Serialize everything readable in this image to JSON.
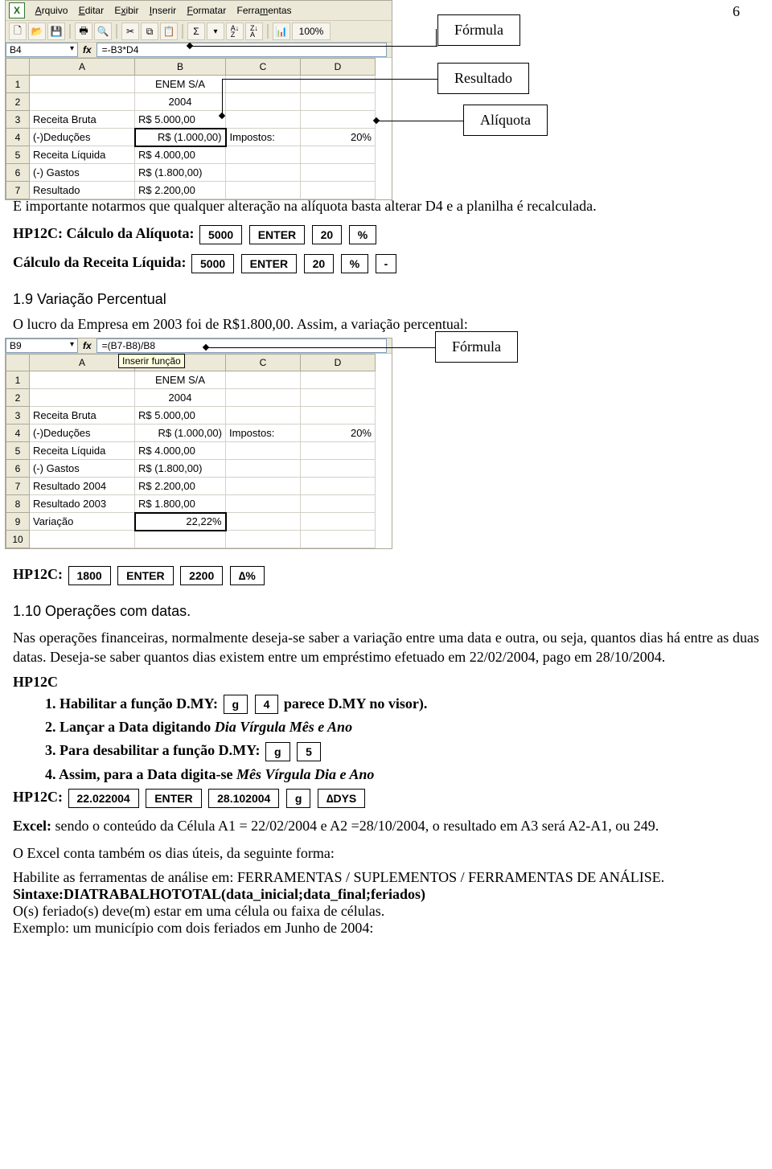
{
  "page_number": "6",
  "excel1": {
    "menu": {
      "arquivo": "Arquivo",
      "editar": "Editar",
      "exibir": "Exibir",
      "inserir": "Inserir",
      "formatar": "Formatar",
      "ferramentas": "Ferramentas"
    },
    "zoom": "100%",
    "namebox": "B4",
    "formula": "=-B3*D4",
    "cols": [
      "A",
      "B",
      "C",
      "D"
    ],
    "rows": [
      {
        "n": "1",
        "a": "",
        "b": "ENEM S/A",
        "c": "",
        "d": ""
      },
      {
        "n": "2",
        "a": "",
        "b": "2004",
        "c": "",
        "d": ""
      },
      {
        "n": "3",
        "a": "Receita Bruta",
        "b": "R$  5.000,00",
        "c": "",
        "d": ""
      },
      {
        "n": "4",
        "a": "(-)Deduções",
        "b": "R$ (1.000,00)",
        "c": "Impostos:",
        "d": "20%"
      },
      {
        "n": "5",
        "a": "Receita Líquida",
        "b": "R$  4.000,00",
        "c": "",
        "d": ""
      },
      {
        "n": "6",
        "a": "(-) Gastos",
        "b": "R$ (1.800,00)",
        "c": "",
        "d": ""
      },
      {
        "n": "7",
        "a": "Resultado",
        "b": "R$  2.200,00",
        "c": "",
        "d": ""
      }
    ]
  },
  "ann": {
    "formula": "Fórmula",
    "resultado": "Resultado",
    "aliquota": "Alíquota",
    "formula2": "Fórmula"
  },
  "para1": "É importante notarmos que qualquer alteração na alíquota basta alterar D4 e a planilha é recalculada.",
  "hp_aliq_label": "HP12C: Cálculo da Alíquota:",
  "keys1": {
    "k1": "5000",
    "k2": "ENTER",
    "k3": "20",
    "k4": "%"
  },
  "receita_label": "Cálculo da Receita Líquida:",
  "keys2": {
    "k1": "5000",
    "k2": "ENTER",
    "k3": "20",
    "k4": "%",
    "k5": "-"
  },
  "h19": "1.9  Variação Percentual",
  "para2": "O lucro da Empresa em 2003 foi de R$1.800,00. Assim, a variação percentual:",
  "excel2": {
    "namebox": "B9",
    "formula": "=(B7-B8)/B8",
    "insfunc": "Inserir função",
    "cols": [
      "A",
      "B",
      "C",
      "D"
    ],
    "rows": [
      {
        "n": "1",
        "a": "",
        "b": "ENEM S/A",
        "c": "",
        "d": ""
      },
      {
        "n": "2",
        "a": "",
        "b": "2004",
        "c": "",
        "d": ""
      },
      {
        "n": "3",
        "a": "Receita Bruta",
        "b": "R$  5.000,00",
        "c": "",
        "d": ""
      },
      {
        "n": "4",
        "a": "(-)Deduções",
        "b": "R$ (1.000,00)",
        "c": "Impostos:",
        "d": "20%"
      },
      {
        "n": "5",
        "a": "Receita Líquida",
        "b": "R$  4.000,00",
        "c": "",
        "d": ""
      },
      {
        "n": "6",
        "a": "(-) Gastos",
        "b": "R$ (1.800,00)",
        "c": "",
        "d": ""
      },
      {
        "n": "7",
        "a": "Resultado 2004",
        "b": "R$  2.200,00",
        "c": "",
        "d": ""
      },
      {
        "n": "8",
        "a": "Resultado 2003",
        "b": "R$  1.800,00",
        "c": "",
        "d": ""
      },
      {
        "n": "9",
        "a": "Variação",
        "b": "22,22%",
        "c": "",
        "d": ""
      },
      {
        "n": "10",
        "a": "",
        "b": "",
        "c": "",
        "d": ""
      }
    ]
  },
  "hp12c_l": "HP12C:",
  "keys3": {
    "k1": "1800",
    "k2": "ENTER",
    "k3": "2200",
    "k4": "∆%"
  },
  "h110": "1.10  Operações com datas.",
  "para3": "Nas operações financeiras, normalmente deseja-se saber a variação entre uma data e outra, ou seja, quantos dias há entre as duas datas. Deseja-se saber quantos dias existem entre um empréstimo efetuado em 22/02/2004, pago em 28/10/2004.",
  "hp12c_plain": "HP12C",
  "steps": {
    "s1_a": "1. Habilitar a função D.MY:",
    "s1_b": "parece D.MY no visor).",
    "s2": "2. Lançar a Data digitando ",
    "s2_i": "Dia Vírgula Mês e Ano",
    "s3": "3. Para desabilitar a função D.MY:",
    "s4": "4. Assim, para a Data digita-se ",
    "s4_i": "Mês Vírgula Dia  e Ano",
    "k_g": "g",
    "k_4": "4",
    "k_5": "5"
  },
  "keys4": {
    "k1": "22.022004",
    "k2": "ENTER",
    "k3": "28.102004",
    "k4": "g",
    "k5": "∆DYS"
  },
  "para4_a": "Excel:",
  "para4_b": " sendo o conteúdo da Célula A1 = 22/02/2004 e A2 =28/10/2004, o resultado em A3 será A2-A1, ou 249.",
  "para5": "O Excel conta também os dias úteis, da seguinte forma:",
  "para6": "Habilite as ferramentas de análise em: FERRAMENTAS / SUPLEMENTOS / FERRAMENTAS DE ANÁLISE.",
  "para7": "Sintaxe:DIATRABALHOTOTAL(data_inicial;data_final;feriados)",
  "para8": "O(s) feriado(s) deve(m) estar em uma célula ou faixa de células.",
  "para9": "Exemplo: um município com dois feriados em Junho de 2004:"
}
